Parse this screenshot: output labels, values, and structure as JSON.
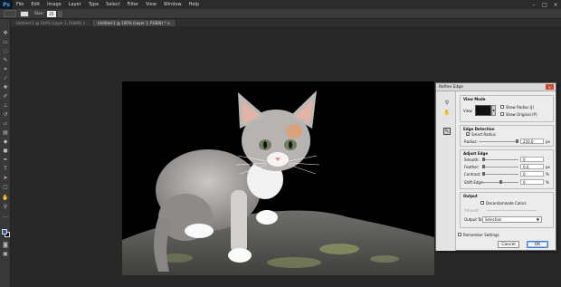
{
  "app": {
    "logo": "Ps"
  },
  "menu": [
    "File",
    "Edit",
    "Image",
    "Layer",
    "Type",
    "Select",
    "Filter",
    "View",
    "Window",
    "Help"
  ],
  "options": {
    "size_label": "Size:",
    "size_value": "25"
  },
  "tabs": [
    {
      "label": "Untitled-1 @ 100% (Layer 1, RGB/8) ×",
      "active": false
    },
    {
      "label": "Untitled-1 @ 100% (Layer 1, RGB/8) * ×",
      "active": true
    }
  ],
  "colors": {
    "foreground": "#1e5fb0",
    "background": "#000000"
  },
  "dialog": {
    "title": "Refine Edge",
    "view_mode": {
      "heading": "View Mode",
      "view_label": "View:",
      "show_radius": "Show Radius (J)",
      "show_original": "Show Original (P)"
    },
    "edge_detection": {
      "heading": "Edge Detection",
      "smart_radius": "Smart Radius",
      "smart_radius_checked": true,
      "radius_label": "Radius:",
      "radius_value": "250.0",
      "radius_unit": "px",
      "radius_level": 0.95
    },
    "adjust_edge": {
      "heading": "Adjust Edge",
      "rows": [
        {
          "label": "Smooth:",
          "value": "0",
          "unit": "",
          "level": 0.0
        },
        {
          "label": "Feather:",
          "value": "0.0",
          "unit": "px",
          "level": 0.0
        },
        {
          "label": "Contrast:",
          "value": "0",
          "unit": "%",
          "level": 0.0
        },
        {
          "label": "Shift Edge:",
          "value": "0",
          "unit": "%",
          "level": 0.5
        }
      ]
    },
    "output": {
      "heading": "Output",
      "decontaminate": "Decontaminate Colors",
      "amount_label": "Amount:",
      "output_to_label": "Output To:",
      "output_to_value": "Selection"
    },
    "remember": "Remember Settings",
    "cancel": "Cancel",
    "ok": "OK"
  }
}
